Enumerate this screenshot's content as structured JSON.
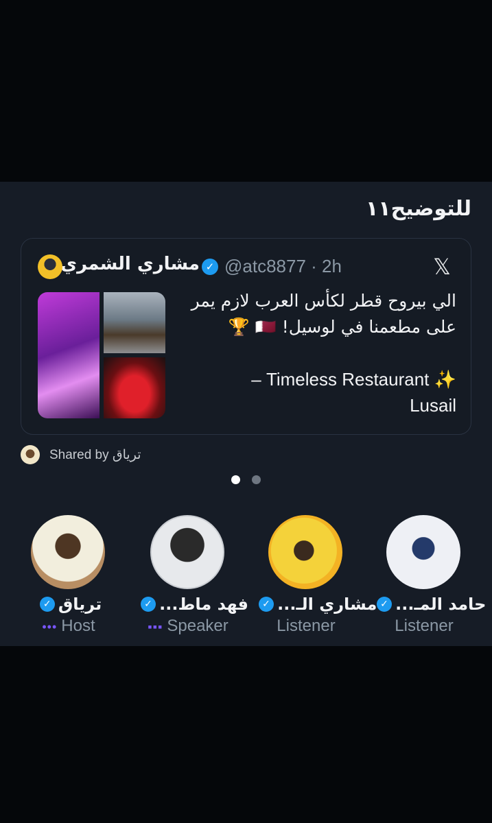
{
  "panel": {
    "title": "للتوضيح١١"
  },
  "tweet": {
    "author_name": "مشاري الشمري",
    "handle_time": "@atc8877 · 2h",
    "x_icon": "x-logo-icon",
    "verified_icon": "verified-badge-icon",
    "verified_glyph": "✓",
    "text_lines": [
      "الي بيروح قطر لكأس العرب لازم يمر",
      "على مطعمنا في لوسيل! 🇶🇦 🏆",
      "✨ Timeless Restaurant –",
      "Lusail"
    ],
    "media_count": 3
  },
  "shared_by": {
    "label": "Shared by تریاق"
  },
  "pagination": {
    "total": 2,
    "active": 1
  },
  "participants": [
    {
      "name": "تریاق",
      "role": "Host",
      "role_icon": "•••"
    },
    {
      "name": "فهد ماط...",
      "role": "Speaker",
      "role_icon": "▪▪▪"
    },
    {
      "name": "مشاري الـ...",
      "role": "Listener",
      "role_icon": ""
    },
    {
      "name": "حامد المـ...",
      "role": "Listener",
      "role_icon": ""
    }
  ],
  "colors": {
    "panel_bg": "#161c26",
    "verified_blue": "#1d9bf0",
    "accent_purple": "#7856ff",
    "muted_text": "#8b98a5"
  }
}
